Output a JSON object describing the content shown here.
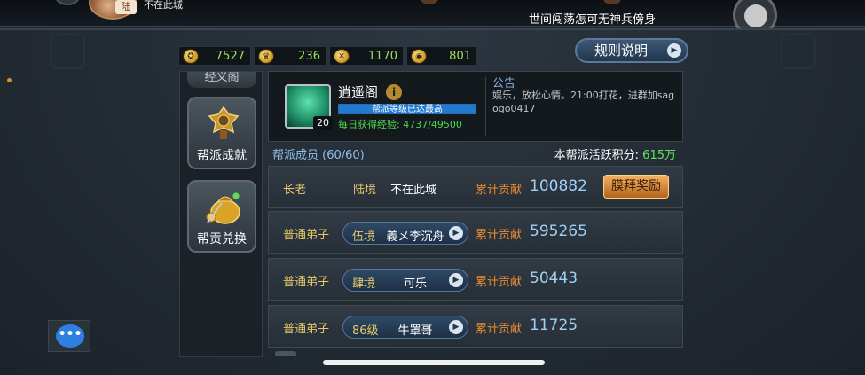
{
  "top_bar": {
    "avatar_tag": "陆",
    "location_status": "不在此城",
    "marquee": "世间闯荡怎可无神兵傍身"
  },
  "currency": [
    {
      "icon": "medal-coin-icon",
      "value": "7527"
    },
    {
      "icon": "helmet-coin-icon",
      "value": "236"
    },
    {
      "icon": "crossed-weapons-coin-icon",
      "value": "1170"
    },
    {
      "icon": "dragon-coin-icon",
      "value": "801"
    }
  ],
  "rules_button": {
    "label": "规则说明"
  },
  "side_menu": {
    "top_item": "经义阁",
    "items": [
      {
        "label": "帮派成就",
        "icon": "medal-icon"
      },
      {
        "label": "帮贡兑换",
        "icon": "money-bag-icon"
      }
    ]
  },
  "guild": {
    "name": "逍遥阁",
    "level": "20",
    "level_status": "帮派等级已达最高",
    "level_fill_fraction": 1.0,
    "daily_exp": "每日获得经验: 4737/49500"
  },
  "notice": {
    "title": "公告",
    "text": "娱乐，放松心情。21:00打花，进群加sagogo0417"
  },
  "members_header": {
    "count": "帮派成员 (60/60)",
    "activity_label": "本帮派活跃积分:",
    "activity_value": "615万"
  },
  "members": [
    {
      "rank": "长老",
      "realm": "陆境",
      "name": "不在此城",
      "contrib_label": "累计贡献",
      "contrib": "100882",
      "action": "膜拜奖励"
    },
    {
      "rank": "普通弟子",
      "realm": "伍境",
      "name": "義メ李沉舟",
      "contrib_label": "累计贡献",
      "contrib": "595265"
    },
    {
      "rank": "普通弟子",
      "realm": "肆境",
      "name": "可乐",
      "contrib_label": "累计贡献",
      "contrib": "50443"
    },
    {
      "rank": "普通弟子",
      "realm": "86级",
      "name": "牛罩哥",
      "contrib_label": "累计贡献",
      "contrib": "11725"
    }
  ],
  "chat": {
    "icon_text": "•••"
  },
  "colors": {
    "accent_gold": "#e8c86a",
    "contrib_orange": "#e88a30",
    "contrib_value": "#9fd0f5",
    "green": "#5fe05f",
    "level_bar": "#1f7ad0"
  }
}
